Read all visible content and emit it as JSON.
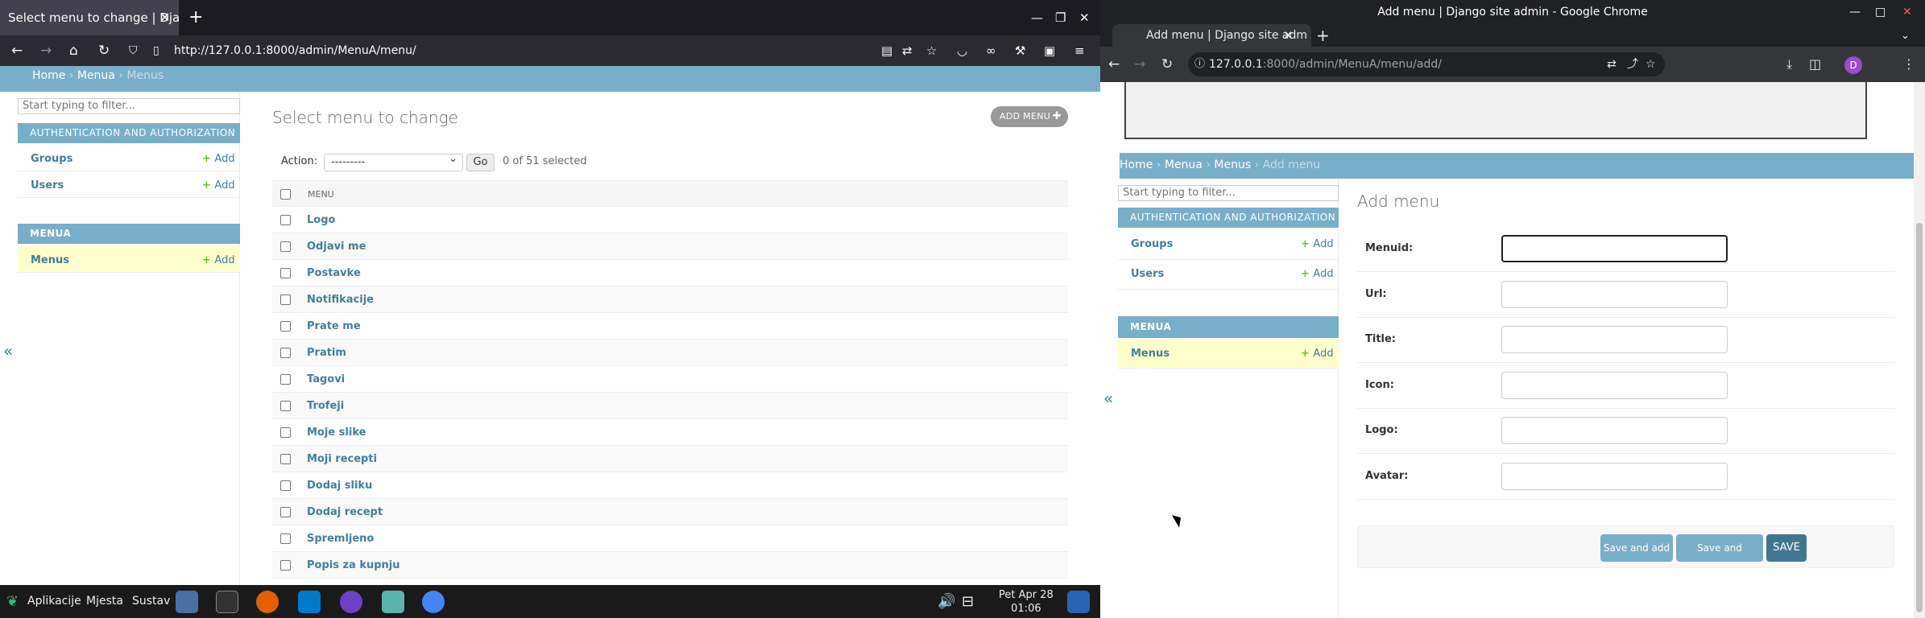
{
  "left_browser": {
    "tab_title": "Select menu to change | Djan",
    "url": "http://127.0.0.1:8000/admin/MenuA/menu/"
  },
  "left_page": {
    "breadcrumbs": {
      "home": "Home",
      "sep1": "›",
      "app": "Menua",
      "sep2": "›",
      "current": "Menus"
    },
    "filter_placeholder": "Start typing to filter...",
    "sidebar": {
      "auth_caption": "AUTHENTICATION AND AUTHORIZATION",
      "auth_items": [
        {
          "label": "Groups",
          "add": "Add"
        },
        {
          "label": "Users",
          "add": "Add"
        }
      ],
      "app_caption": "MENUA",
      "app_items": [
        {
          "label": "Menus",
          "add": "Add"
        }
      ],
      "collapse": "«"
    },
    "title": "Select menu to change",
    "add_button": "ADD MENU",
    "action_label": "Action:",
    "action_value": "---------",
    "go_label": "Go",
    "selection_count": "0 of 51 selected",
    "column_header": "MENU",
    "rows": [
      "Logo",
      "Odjavi me",
      "Postavke",
      "Notifikacije",
      "Prate me",
      "Pratim",
      "Tagovi",
      "Trofeji",
      "Moje slike",
      "Moji recepti",
      "Dodaj sliku",
      "Dodaj recept",
      "Spremljeno",
      "Popis za kupnju"
    ]
  },
  "taskbar": {
    "apps_label": "Aplikacije",
    "places_label": "Mjesta",
    "system_label": "Sustav",
    "clock_day": "Pet Apr 28",
    "clock_time": "01:06"
  },
  "right_browser": {
    "window_title": "Add menu | Django site admin - Google Chrome",
    "tab_title": "Add menu | Django site adm",
    "url_host": "127.0.0.1",
    "url_rest": ":8000/admin/MenuA/menu/add/",
    "avatar": "D"
  },
  "right_page": {
    "breadcrumbs": {
      "home": "Home",
      "sep1": "›",
      "app": "Menua",
      "sep2": "›",
      "model": "Menus",
      "sep3": "›",
      "current": "Add menu"
    },
    "filter_placeholder": "Start typing to filter...",
    "sidebar": {
      "auth_caption": "AUTHENTICATION AND AUTHORIZATION",
      "auth_items": [
        {
          "label": "Groups",
          "add": "Add"
        },
        {
          "label": "Users",
          "add": "Add"
        }
      ],
      "app_caption": "MENUA",
      "app_items": [
        {
          "label": "Menus",
          "add": "Add"
        }
      ],
      "collapse": "«"
    },
    "title": "Add menu",
    "fields": [
      {
        "label": "Menuid:",
        "value": ""
      },
      {
        "label": "Url:",
        "value": ""
      },
      {
        "label": "Title:",
        "value": ""
      },
      {
        "label": "Icon:",
        "value": ""
      },
      {
        "label": "Logo:",
        "value": ""
      },
      {
        "label": "Avatar:",
        "value": ""
      }
    ],
    "buttons": {
      "save_add_another": "Save and add another",
      "save_continue": "Save and continue editing",
      "save": "SAVE"
    }
  },
  "colors": {
    "header_blue": "#79aec8",
    "link": "#447e9b",
    "save_dark": "#417690",
    "add_green": "#70bf2b"
  }
}
